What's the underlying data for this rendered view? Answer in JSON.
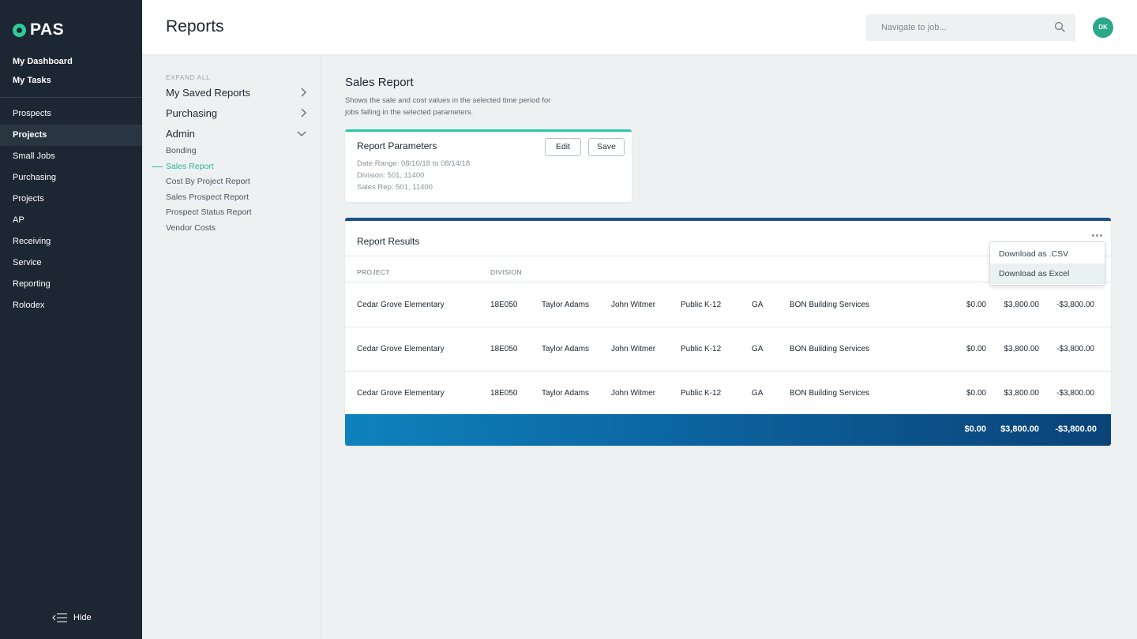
{
  "app": {
    "logo_text": "PAS",
    "page_title": "Reports"
  },
  "sidebar": {
    "top_items": [
      "My Dashboard",
      "My Tasks"
    ],
    "nav_items": [
      "Prospects",
      "Projects",
      "Small Jobs",
      "Purchasing",
      "Projects",
      "AP",
      "Receiving",
      "Service",
      "Reporting",
      "Rolodex"
    ],
    "active_item": "Projects",
    "hide_label": "Hide"
  },
  "topbar": {
    "search_placeholder": "Navigate to job...",
    "avatar_initials": "DK"
  },
  "tree": {
    "expand_all": "EXPAND ALL",
    "groups": [
      "My Saved Reports",
      "Purchasing",
      "Admin"
    ],
    "admin_items": [
      "Bonding",
      "Sales Report",
      "Cost By Project Report",
      "Sales Prospect Report",
      "Prospect Status Report",
      "Vendor Costs"
    ],
    "active_leaf": "Sales Report"
  },
  "report": {
    "title": "Sales Report",
    "description": "Shows the sale and cost values in the selected time period for jobs falling in the selected parameters."
  },
  "parameters": {
    "title": "Report Parameters",
    "edit_label": "Edit",
    "save_label": "Save",
    "lines": [
      "Date Range: 08/10/18 to 08/14/18",
      "Division: 501, 11400",
      "Sales Rep: 501, 11400"
    ]
  },
  "results": {
    "title": "Report Results",
    "headers": [
      "PROJECT",
      "DIVISION"
    ],
    "rows": [
      [
        "Cedar Grove Elementary",
        "18E050",
        "Taylor Adams",
        "John Witmer",
        "Public K-12",
        "GA",
        "BON Building Services",
        "$0.00",
        "$3,800.00",
        "-$3,800.00"
      ],
      [
        "Cedar Grove Elementary",
        "18E050",
        "Taylor Adams",
        "John Witmer",
        "Public K-12",
        "GA",
        "BON Building Services",
        "$0.00",
        "$3,800.00",
        "-$3,800.00"
      ],
      [
        "Cedar Grove Elementary",
        "18E050",
        "Taylor Adams",
        "John Witmer",
        "Public K-12",
        "GA",
        "BON Building Services",
        "$0.00",
        "$3,800.00",
        "-$3,800.00"
      ]
    ],
    "totals": [
      "$0.00",
      "$3,800.00",
      "-$3,800.00"
    ]
  },
  "download_menu": {
    "options": [
      "Download as .CSV",
      "Download as Excel"
    ],
    "hovered": "Download as Excel"
  },
  "colors": {
    "sidebar_bg": "#1c2733",
    "accent_green": "#2cb39a",
    "results_header_blue": "#1a4f8a",
    "totals_gradient_start": "#0e82bd",
    "totals_gradient_end": "#0a4378"
  }
}
